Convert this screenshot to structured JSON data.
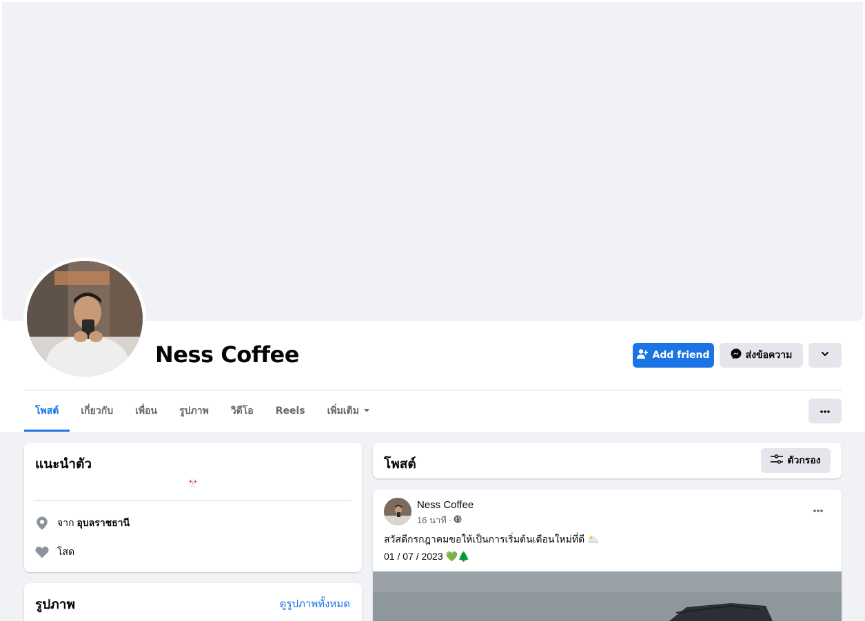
{
  "profile": {
    "name": "Ness Coffee"
  },
  "actions": {
    "add_friend": "Add friend",
    "message": "ส่งข้อความ"
  },
  "tabs": [
    {
      "label": "โพสต์",
      "active": true
    },
    {
      "label": "เกี่ยวกับ"
    },
    {
      "label": "เพื่อน"
    },
    {
      "label": "รูปภาพ"
    },
    {
      "label": "วิดีโอ"
    },
    {
      "label": "Reels"
    },
    {
      "label": "เพิ่มเติม"
    }
  ],
  "intro": {
    "title": "แนะนำตัว",
    "bio_emoji": "🎌",
    "from_prefix": "จาก",
    "from_place": "อุบลราชธานี",
    "relationship": "โสด"
  },
  "photos": {
    "title": "รูปภาพ",
    "see_all": "ดูรูปภาพทั้งหมด"
  },
  "posts_header": {
    "title": "โพสต์",
    "filter": "ตัวกรอง"
  },
  "post": {
    "author": "Ness Coffee",
    "time": "16 นาที",
    "separator": "·",
    "text": "สวัสดีกรกฎาคมขอให้เป็นการเริ่มต้นเดือนใหม่ที่ดี 🌥️",
    "date_line": "01 / 07 / 2023 💚🌲"
  },
  "colors": {
    "accent": "#1b74e4",
    "page_bg": "#f0f2f5",
    "button_grey": "#e4e6eb",
    "secondary_text": "#65676b"
  }
}
